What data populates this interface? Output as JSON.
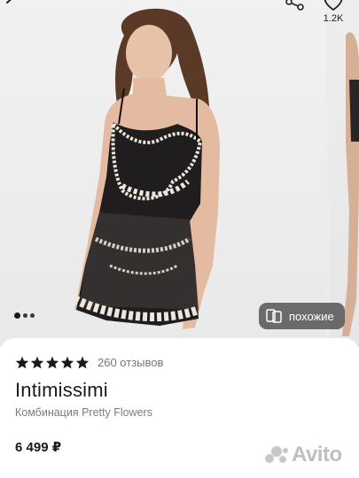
{
  "header": {
    "favorites_count": "1.2K",
    "icons": [
      "back-arrow-icon",
      "share-icon",
      "heart-icon"
    ]
  },
  "gallery": {
    "image_description": "product-photo",
    "pager": {
      "active_index": 0,
      "visible_dots": 3
    },
    "similar_label": "похожие"
  },
  "product": {
    "rating": 5,
    "reviews_label": "260 отзывов",
    "brand": "Intimissimi",
    "subtitle": "Комбинация Pretty Flowers",
    "price": "6 499 ₽"
  },
  "watermark": {
    "text": "Avito"
  },
  "colors": {
    "accent": "#1a1a1a",
    "muted": "#7c7c7c",
    "overlay": "#464646"
  }
}
